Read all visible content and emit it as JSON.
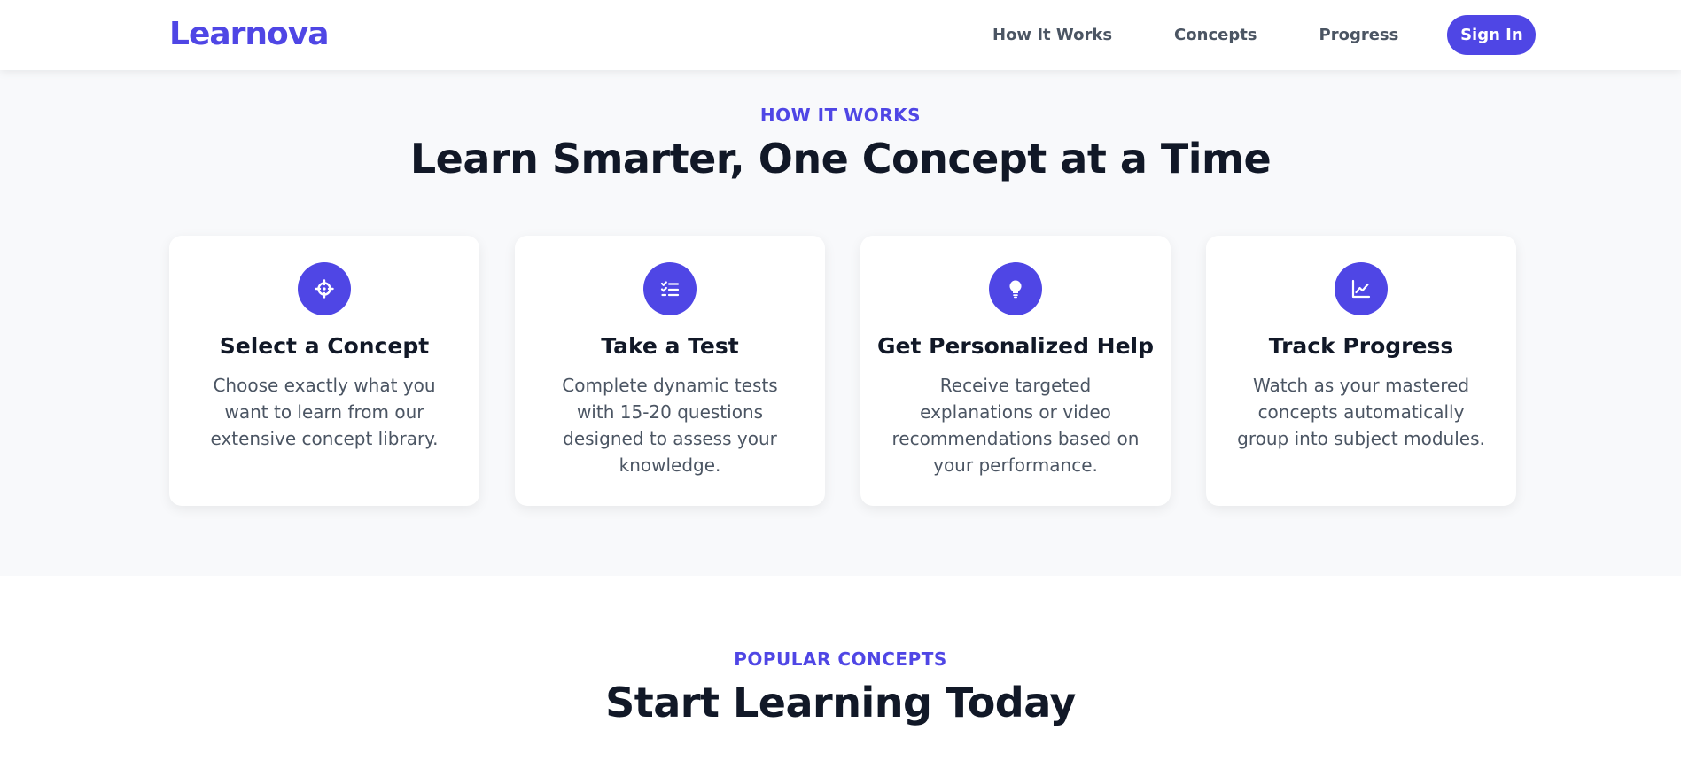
{
  "nav": {
    "logo": "Learnova",
    "links": [
      "How It Works",
      "Concepts",
      "Progress"
    ],
    "sign_in": "Sign In"
  },
  "how_it_works": {
    "eyebrow": "HOW IT WORKS",
    "title": "Learn Smarter, One Concept at a Time",
    "cards": [
      {
        "icon": "crosshair-icon",
        "title": "Select a Concept",
        "description": "Choose exactly what you want to learn from our extensive concept library."
      },
      {
        "icon": "checklist-icon",
        "title": "Take a Test",
        "description": "Complete dynamic tests with 15-20 questions designed to assess your knowledge."
      },
      {
        "icon": "lightbulb-icon",
        "title": "Get Personalized Help",
        "description": "Receive targeted explanations or video recommendations based on your performance."
      },
      {
        "icon": "line-chart-icon",
        "title": "Track Progress",
        "description": "Watch as your mastered concepts automatically group into subject modules."
      }
    ]
  },
  "popular": {
    "eyebrow": "POPULAR CONCEPTS",
    "title": "Start Learning Today"
  },
  "colors": {
    "accent": "#4f46e5",
    "heading": "#111827",
    "body_text": "#4b5563",
    "section_bg": "#f8f9fb"
  }
}
